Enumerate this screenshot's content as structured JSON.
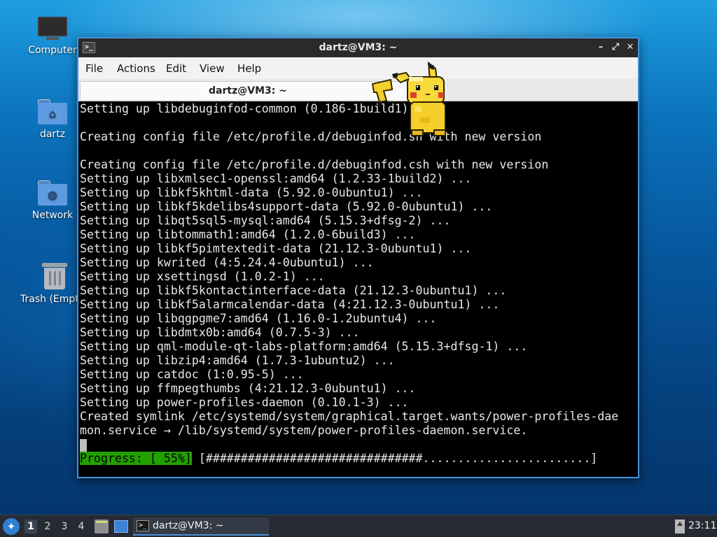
{
  "desktop": {
    "icons": [
      {
        "label": "Computer"
      },
      {
        "label": "dartz"
      },
      {
        "label": "Network"
      },
      {
        "label": "Trash (Empty)"
      }
    ]
  },
  "window": {
    "title": "dartz@VM3: ~",
    "menu": [
      "File",
      "Actions",
      "Edit",
      "View",
      "Help"
    ],
    "tab_label": "dartz@VM3: ~"
  },
  "terminal": {
    "lines": [
      "Setting up libdebuginfod-common (0.186-1build1) ...",
      "",
      "Creating config file /etc/profile.d/debuginfod.sh with new version",
      "",
      "Creating config file /etc/profile.d/debuginfod.csh with new version",
      "Setting up libxmlsec1-openssl:amd64 (1.2.33-1build2) ...",
      "Setting up libkf5khtml-data (5.92.0-0ubuntu1) ...",
      "Setting up libkf5kdelibs4support-data (5.92.0-0ubuntu1) ...",
      "Setting up libqt5sql5-mysql:amd64 (5.15.3+dfsg-2) ...",
      "Setting up libtommath1:amd64 (1.2.0-6build3) ...",
      "Setting up libkf5pimtextedit-data (21.12.3-0ubuntu1) ...",
      "Setting up kwrited (4:5.24.4-0ubuntu1) ...",
      "Setting up xsettingsd (1.0.2-1) ...",
      "Setting up libkf5kontactinterface-data (21.12.3-0ubuntu1) ...",
      "Setting up libkf5alarmcalendar-data (4:21.12.3-0ubuntu1) ...",
      "Setting up libqgpgme7:amd64 (1.16.0-1.2ubuntu4) ...",
      "Setting up libdmtx0b:amd64 (0.7.5-3) ...",
      "Setting up qml-module-qt-labs-platform:amd64 (5.15.3+dfsg-1) ...",
      "Setting up libzip4:amd64 (1.7.3-1ubuntu2) ...",
      "Setting up catdoc (1:0.95-5) ...",
      "Setting up ffmpegthumbs (4:21.12.3-0ubuntu1) ...",
      "Setting up power-profiles-daemon (0.10.1-3) ...",
      "Created symlink /etc/systemd/system/graphical.target.wants/power-profiles-dae",
      "mon.service → /lib/systemd/system/power-profiles-daemon.service."
    ],
    "progress_label": "Progress: [ 55%]",
    "progress_bar": " [###############################........................]",
    "progress_value": 55
  },
  "taskbar": {
    "workspaces": [
      "1",
      "2",
      "3",
      "4"
    ],
    "active_workspace": "1",
    "task_label": "dartz@VM3: ~",
    "clock": "23:11"
  },
  "colors": {
    "accent": "#4a90d9",
    "progress_green": "#22a000",
    "terminal_bg": "#000000"
  }
}
